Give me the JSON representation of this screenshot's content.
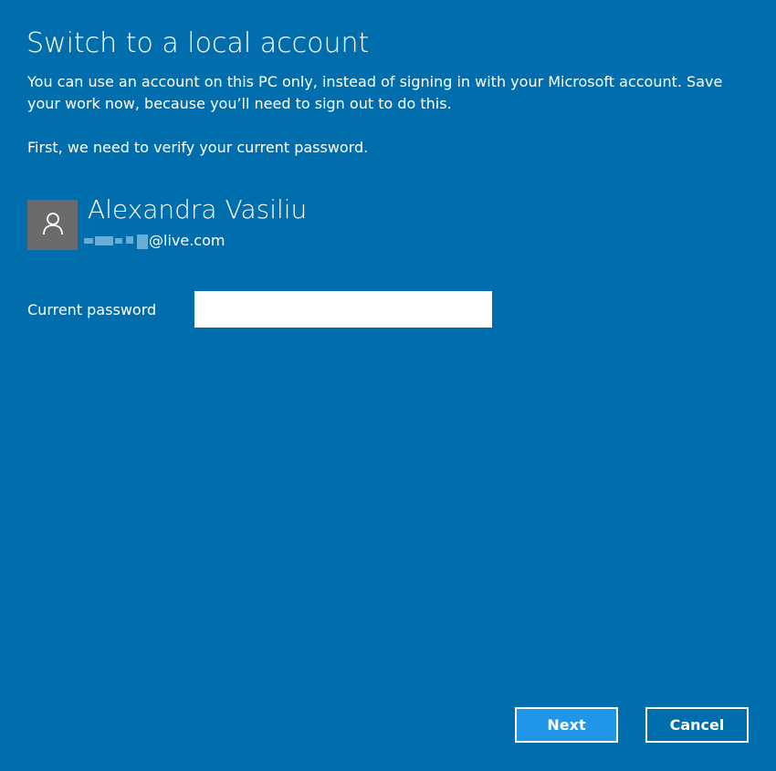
{
  "dialog": {
    "title": "Switch to a local account",
    "description": "You can use an account on this PC only, instead of signing in with your Microsoft account. Save your work now, because you’ll need to sign out to do this.",
    "verify_text": "First, we need to verify your current password."
  },
  "account": {
    "avatar_icon": "user-icon",
    "name": "Alexandra Vasiliu",
    "email_domain": "@live.com"
  },
  "password": {
    "label": "Current password",
    "value": ""
  },
  "buttons": {
    "next_label": "Next",
    "cancel_label": "Cancel"
  },
  "colors": {
    "background": "#006ead",
    "primary_button": "#2196e8",
    "avatar_bg": "#6b6b6b"
  }
}
